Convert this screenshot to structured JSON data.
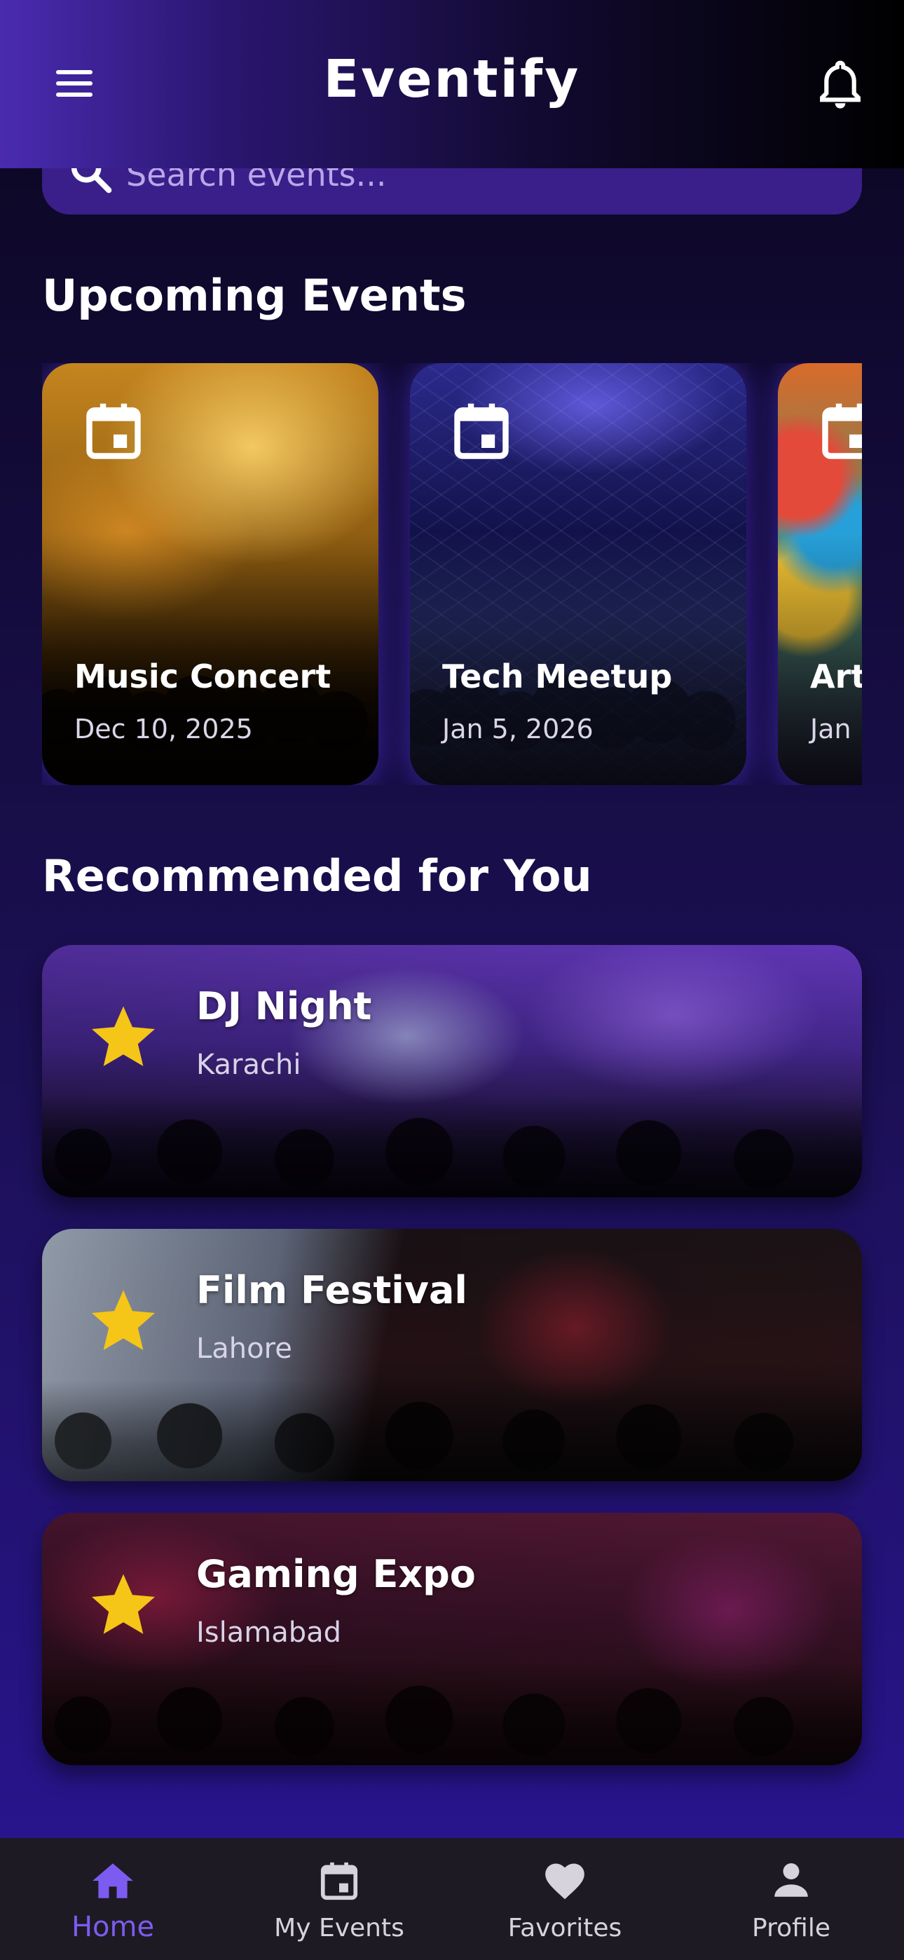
{
  "header": {
    "title": "Eventify"
  },
  "search": {
    "placeholder": "Search events..."
  },
  "upcoming": {
    "title": "Upcoming Events",
    "events": [
      {
        "name": "Music Concert",
        "date": "Dec 10, 2025"
      },
      {
        "name": "Tech Meetup",
        "date": "Jan 5, 2026"
      },
      {
        "name": "Art",
        "date": "Jan"
      }
    ]
  },
  "recommended": {
    "title": "Recommended for You",
    "events": [
      {
        "name": "DJ Night",
        "location": "Karachi"
      },
      {
        "name": "Film Festival",
        "location": "Lahore"
      },
      {
        "name": "Gaming Expo",
        "location": "Islamabad"
      }
    ]
  },
  "bottom_nav": {
    "items": [
      {
        "label": "Home",
        "icon": "home-icon",
        "active": true
      },
      {
        "label": "My Events",
        "icon": "calendar-icon",
        "active": false
      },
      {
        "label": "Favorites",
        "icon": "heart-icon",
        "active": false
      },
      {
        "label": "Profile",
        "icon": "person-icon",
        "active": false
      }
    ]
  },
  "colors": {
    "accent": "#7c5cf0",
    "star": "#f5c518",
    "nav_background": "#1d1a24"
  }
}
